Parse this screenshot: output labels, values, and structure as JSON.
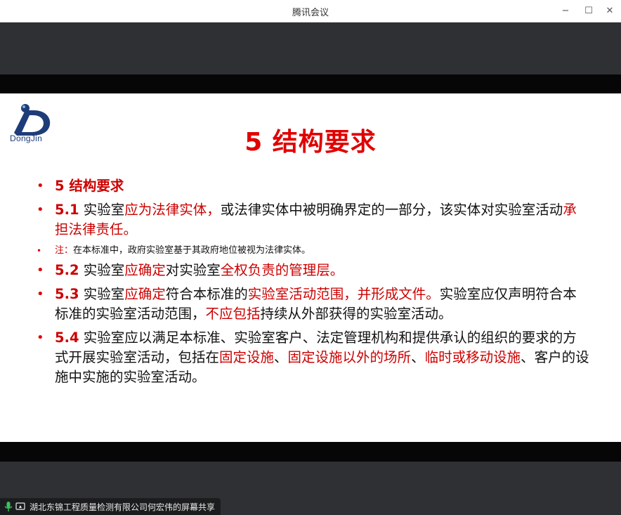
{
  "window": {
    "title": "腾讯会议",
    "controls": {
      "minimize": "−",
      "maximize": "☐",
      "close": "✕"
    }
  },
  "slide": {
    "logo_text": "DongJin",
    "title": "5  结构要求",
    "items": [
      {
        "num": "5",
        "parts": [
          {
            "text": "  结构要求",
            "style": "red"
          }
        ]
      },
      {
        "num": "5.1",
        "parts": [
          {
            "text": " 实验室",
            "style": "normal"
          },
          {
            "text": "应为法律实体，",
            "style": "red"
          },
          {
            "text": "或法律实体中被明确界定的一部分，该实体对实验室活动",
            "style": "normal"
          },
          {
            "text": "承担法律责任。",
            "style": "red"
          }
        ]
      },
      {
        "num": "",
        "small": true,
        "parts": [
          {
            "text": "注：",
            "style": "red"
          },
          {
            "text": "在本标准中，政府实验室基于其政府地位被视为法律实体。",
            "style": "normal"
          }
        ]
      },
      {
        "num": "5.2",
        "parts": [
          {
            "text": " 实验室",
            "style": "normal"
          },
          {
            "text": "应确定",
            "style": "red"
          },
          {
            "text": "对实验室",
            "style": "normal"
          },
          {
            "text": "全权负责的管理层。",
            "style": "red"
          }
        ]
      },
      {
        "num": "5.3",
        "parts": [
          {
            "text": " 实验室",
            "style": "normal"
          },
          {
            "text": "应确定",
            "style": "red"
          },
          {
            "text": "符合本标准的",
            "style": "normal"
          },
          {
            "text": "实验室活动范围，并形成文件。",
            "style": "red"
          },
          {
            "text": "实验室应仅声明符合本标准的实验室活动范围，",
            "style": "normal"
          },
          {
            "text": "不应包括",
            "style": "red"
          },
          {
            "text": "持续从外部获得的实验室活动。",
            "style": "normal"
          }
        ]
      },
      {
        "num": "5.4",
        "parts": [
          {
            "text": " 实验室应以满足本标准、实验室客户、法定管理机构和提供承认的组织的要求的方式开展实验室活动，包括在",
            "style": "normal"
          },
          {
            "text": "固定设施",
            "style": "red"
          },
          {
            "text": "、",
            "style": "normal"
          },
          {
            "text": "固定设施以外的场所",
            "style": "red"
          },
          {
            "text": "、",
            "style": "normal"
          },
          {
            "text": "临时或移动设施",
            "style": "red"
          },
          {
            "text": "、客户的设施中实施的实验室活动。",
            "style": "normal"
          }
        ]
      }
    ]
  },
  "status": {
    "share_text": "湖北东锦工程质量检测有限公司何宏伟的屏幕共享",
    "mic_icon": "microphone-icon",
    "screen_icon": "screen-share-icon"
  },
  "colors": {
    "accent_red": "#cc0000",
    "logo_blue": "#1e3c78"
  }
}
